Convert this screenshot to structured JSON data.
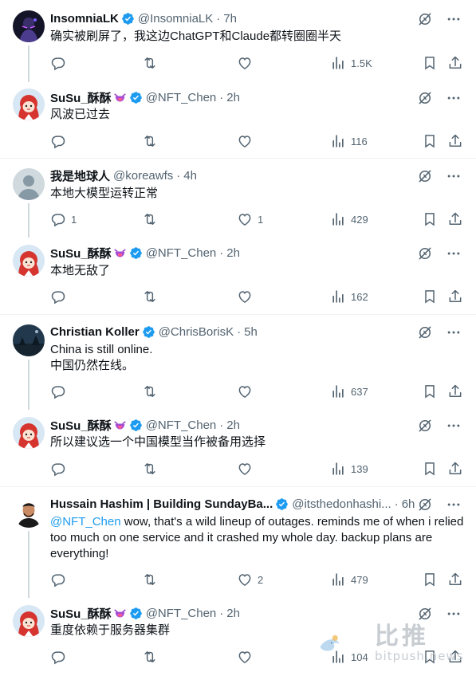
{
  "tweets": [
    {
      "name": "InsomniaLK",
      "handle": "@InsomniaLK",
      "dot": "·",
      "time": "7h",
      "text": "确实被刷屏了，我这边ChatGPT和Claude都转圈圈半天",
      "reply_count": "",
      "retweet_count": "",
      "like_count": "",
      "view_count": "1.5K",
      "avatar": "dark-figure-avatar"
    },
    {
      "name": "SuSu_酥酥",
      "handle": "@NFT_Chen",
      "dot": "·",
      "time": "2h",
      "text": "风波已过去",
      "reply_count": "",
      "retweet_count": "",
      "like_count": "",
      "view_count": "116",
      "avatar": "red-hood-girl-avatar"
    },
    {
      "name": "我是地球人",
      "handle": "@koreawfs",
      "dot": "·",
      "time": "4h",
      "text": "本地大模型运转正常",
      "reply_count": "1",
      "retweet_count": "",
      "like_count": "1",
      "view_count": "429",
      "avatar": "default-avatar"
    },
    {
      "name": "SuSu_酥酥",
      "handle": "@NFT_Chen",
      "dot": "·",
      "time": "2h",
      "text": "本地无敌了",
      "reply_count": "",
      "retweet_count": "",
      "like_count": "",
      "view_count": "162",
      "avatar": "red-hood-girl-avatar"
    },
    {
      "name": "Christian Koller",
      "handle": "@ChrisBorisK",
      "dot": "·",
      "time": "5h",
      "text_line1": "China is still online.",
      "text_line2": "中国仍然在线。",
      "reply_count": "",
      "retweet_count": "",
      "like_count": "",
      "view_count": "637",
      "avatar": "night-landscape-avatar"
    },
    {
      "name": "SuSu_酥酥",
      "handle": "@NFT_Chen",
      "dot": "·",
      "time": "2h",
      "text": "所以建议选一个中国模型当作被备用选择",
      "reply_count": "",
      "retweet_count": "",
      "like_count": "",
      "view_count": "139",
      "avatar": "red-hood-girl-avatar"
    },
    {
      "name": "Hussain Hashim | Building SundayBa...",
      "handle": "@itsthedonhashi...",
      "dot": "·",
      "time": "6h",
      "mention": "@NFT_Chen",
      "text": " wow, that's a wild lineup of outages. reminds me of when i relied too much on one service and it crashed my whole day. backup plans are everything!",
      "reply_count": "",
      "retweet_count": "",
      "like_count": "2",
      "view_count": "479",
      "avatar": "man-portrait-avatar"
    },
    {
      "name": "SuSu_酥酥",
      "handle": "@NFT_Chen",
      "dot": "·",
      "time": "2h",
      "text": "重度依赖于服务器集群",
      "reply_count": "",
      "retweet_count": "",
      "like_count": "",
      "view_count": "104",
      "avatar": "red-hood-girl-avatar"
    }
  ],
  "watermark": {
    "text_cn": "比推",
    "text_en": "bitpush.news"
  },
  "colors": {
    "accent": "#1d9bf0",
    "muted": "#536471",
    "text": "#0f1419",
    "separator": "#eff3f4"
  }
}
